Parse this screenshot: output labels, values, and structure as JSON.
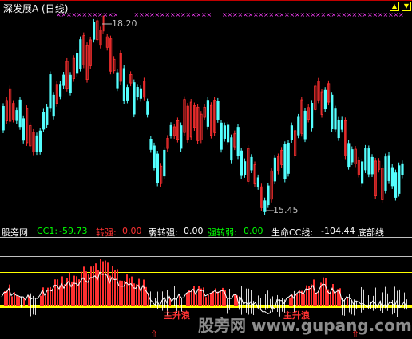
{
  "title": "深发展A (日线)",
  "price_high_label": "18.20",
  "price_low_label": "15.45",
  "indicator": {
    "name": "股旁网",
    "cc1_label": "CC1:",
    "cc1_value": "-59.73",
    "zhuanqiang_label": "转强:",
    "zhuanqiang_value": "0.00",
    "ruozhuanqiang_label": "弱转强:",
    "ruozhuanqiang_value": "0.00",
    "qiangzhuanruo_label": "强转弱:",
    "qiangzhuanruo_value": "0.00",
    "shengming_label": "生命CC线:",
    "shengming_value": "-104.44",
    "dibu_label": "底部线"
  },
  "signal_label": "主升浪",
  "watermark": "股旁网 www.gupang.com",
  "colors": {
    "background": "#000000",
    "up_candle": "#ff3030",
    "down_candle": "#54ffff",
    "marker": "#ff40ff",
    "yellow_line": "#ffff00",
    "white_line": "#ffffff",
    "green_text": "#00ff00",
    "red_text": "#ff3232",
    "gray_line": "#808080"
  }
}
